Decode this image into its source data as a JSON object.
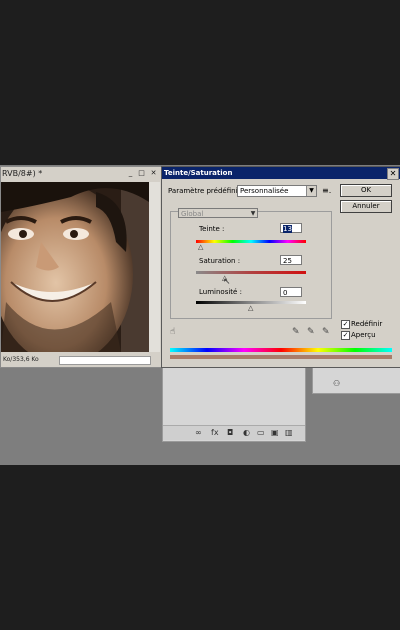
{
  "document": {
    "title": "RVB/8#) *",
    "status": "Ko/353,6 Ko",
    "min_icon": "minimize-icon",
    "max_icon": "maximize-icon",
    "close_icon": "close-icon"
  },
  "dialog": {
    "title": "Teinte/Saturation",
    "close_glyph": "✕",
    "preset_label": "Paramètre prédéfini :",
    "preset_value": "Personnalisée",
    "ok_label": "OK",
    "cancel_label": "Annuler",
    "channel_value": "Global",
    "hue_label": "Teinte :",
    "hue_value": "13",
    "saturation_label": "Saturation :",
    "saturation_value": "25",
    "lightness_label": "Luminosité :",
    "lightness_value": "0",
    "colorize_label": "Redéfinir",
    "colorize_checked": true,
    "preview_label": "Aperçu",
    "preview_checked": true
  },
  "colors": {
    "title_bar": "#0a246a",
    "dialog_bg": "#d4d0c8",
    "workspace": "#7e7e7e",
    "result_bar": "#a97c6a"
  }
}
